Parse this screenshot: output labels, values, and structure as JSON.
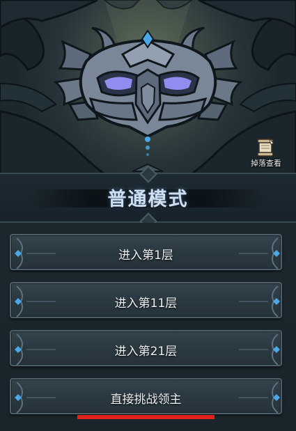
{
  "drop_view": {
    "label": "掉落查看",
    "icon": "scroll-quill-icon"
  },
  "mode": {
    "title": "普通模式"
  },
  "floors": [
    {
      "label": "进入第1层"
    },
    {
      "label": "进入第11层"
    },
    {
      "label": "进入第21层"
    },
    {
      "label": "直接挑战领主"
    }
  ],
  "colors": {
    "background": "#1b262c",
    "title_text": "#cfe0f2",
    "button_text": "#eef2f5",
    "accent_red": "#e0211c",
    "gem_blue": "#4aa8e8",
    "eye_glow": "#8f8ef0"
  }
}
